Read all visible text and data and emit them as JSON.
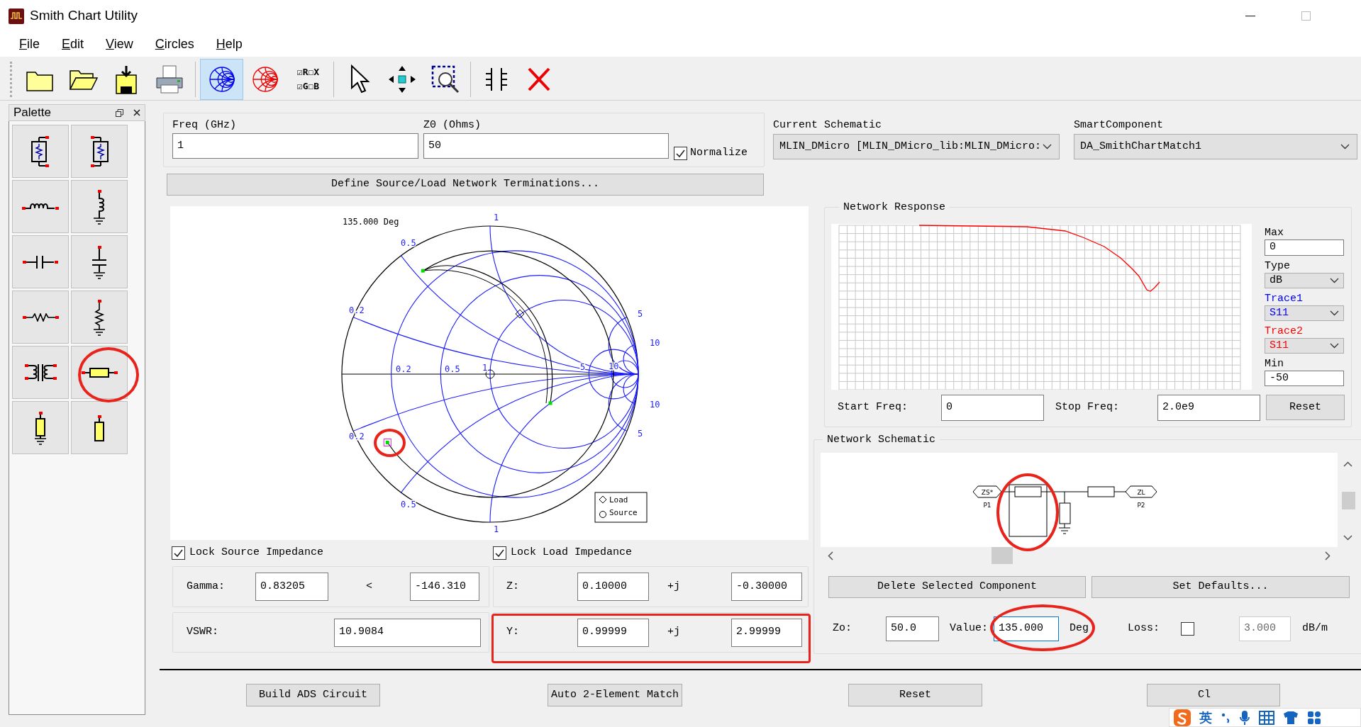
{
  "window": {
    "title": "Smith Chart Utility"
  },
  "menu": [
    {
      "label": "File"
    },
    {
      "label": "Edit"
    },
    {
      "label": "View"
    },
    {
      "label": "Circles"
    },
    {
      "label": "Help"
    }
  ],
  "toolbar": [
    {
      "kind": "folder",
      "selected": false
    },
    {
      "kind": "open-folder",
      "selected": false
    },
    {
      "kind": "save",
      "selected": false
    },
    {
      "kind": "print",
      "selected": false
    },
    {
      "kind": "smith-impedance",
      "selected": true
    },
    {
      "kind": "smith-admittance",
      "selected": false
    },
    {
      "kind": "toggles",
      "lines": [
        "☑R☐X",
        "☑G☐B"
      ]
    },
    {
      "kind": "pointer",
      "selected": false
    },
    {
      "kind": "move",
      "selected": false
    },
    {
      "kind": "zoom",
      "selected": false
    },
    {
      "kind": "table",
      "selected": false
    },
    {
      "kind": "delete",
      "selected": false
    }
  ],
  "palette": {
    "title": "Palette"
  },
  "frequency": {
    "label": "Freq (GHz)",
    "value": "1"
  },
  "z0": {
    "label": "Z0 (Ohms)",
    "value": "50"
  },
  "normalize": {
    "label": "Normalize",
    "checked": true
  },
  "define_button": "Define Source/Load Network Terminations...",
  "current_schematic": {
    "label": "Current Schematic",
    "value": "MLIN_DMicro [MLIN_DMicro_lib:MLIN_DMicro:"
  },
  "smart_component": {
    "label": "SmartComponent",
    "value": "DA_SmithChartMatch1"
  },
  "smith_chart": {
    "angle_label": "135.000 Deg",
    "labels": [
      "1",
      "0.5",
      "0.2",
      "0.2",
      "0.5",
      "1",
      "5",
      "10",
      "5",
      "10",
      "10",
      "5",
      "0.2",
      "0.5",
      "1"
    ],
    "legend": [
      "Load",
      "Source"
    ]
  },
  "lock_source": {
    "label": "Lock Source Impedance",
    "checked": true
  },
  "lock_load": {
    "label": "Lock Load Impedance",
    "checked": true
  },
  "gamma": {
    "label": "Gamma:",
    "magnitude": "0.83205",
    "angle_symbol": "<",
    "angle": "-146.310"
  },
  "z": {
    "label": "Z:",
    "real": "0.10000",
    "j": "+j",
    "imag": "-0.30000"
  },
  "vswr": {
    "label": "VSWR:",
    "value": "10.9084"
  },
  "y": {
    "label": "Y:",
    "real": "0.99999",
    "j": "+j",
    "imag": "2.99999"
  },
  "network_response": {
    "title": "Network Response",
    "max": {
      "label": "Max",
      "value": "0"
    },
    "type": {
      "label": "Type",
      "value": "dB"
    },
    "traces": [
      {
        "label": "Trace1",
        "value": "S11",
        "color": "#0000ff"
      },
      {
        "label": "Trace2",
        "value": "S11",
        "color": "#ff0000"
      }
    ],
    "min": {
      "label": "Min",
      "value": "-50"
    },
    "start_freq": {
      "label": "Start Freq:",
      "value": "0"
    },
    "stop_freq": {
      "label": "Stop Freq:",
      "value": "2.0e9"
    },
    "reset": "Reset"
  },
  "network_schematic": {
    "title": "Network Schematic",
    "ports": [
      {
        "symbol": "ZS*",
        "name": "P1"
      },
      {
        "symbol": "ZL",
        "name": "P2"
      }
    ],
    "delete_button": "Delete Selected Component",
    "defaults_button": "Set Defaults...",
    "zo": {
      "label": "Zo:",
      "value": "50.0"
    },
    "value": {
      "label": "Value:",
      "value": "135.000",
      "unit": "Deg",
      "focused": true
    },
    "loss": {
      "label": "Loss:",
      "checked": false,
      "value": "3.000",
      "disabled": true,
      "unit": "dB/m"
    }
  },
  "bottom_buttons": [
    "Build ADS Circuit",
    "Auto 2-Element Match",
    "Reset",
    "Cl"
  ],
  "ime_bar": {
    "mode": "英"
  }
}
